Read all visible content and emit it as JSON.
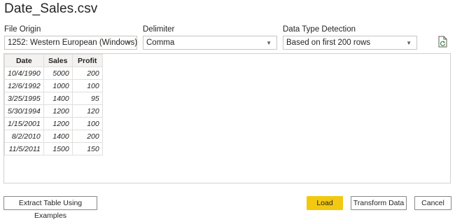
{
  "dialog": {
    "title": "Date_Sales.csv"
  },
  "file_origin": {
    "label": "File Origin",
    "value": "1252: Western European (Windows)"
  },
  "delimiter": {
    "label": "Delimiter",
    "value": "Comma"
  },
  "data_type_detection": {
    "label": "Data Type Detection",
    "value": "Based on first 200 rows"
  },
  "icons": {
    "dropdown": "chevron-down-icon",
    "refresh": "refresh-file-icon"
  },
  "table": {
    "columns": [
      "Date",
      "Sales",
      "Profit"
    ],
    "rows": [
      [
        "10/4/1990",
        "5000",
        "200"
      ],
      [
        "12/6/1992",
        "1000",
        "100"
      ],
      [
        "3/25/1995",
        "1400",
        "95"
      ],
      [
        "5/30/1994",
        "1200",
        "120"
      ],
      [
        "1/15/2001",
        "1200",
        "100"
      ],
      [
        "8/2/2010",
        "1400",
        "200"
      ],
      [
        "11/5/2011",
        "1500",
        "150"
      ]
    ]
  },
  "buttons": {
    "extract": "Extract Table Using Examples",
    "load": "Load",
    "transform": "Transform Data",
    "cancel": "Cancel"
  },
  "colors": {
    "accent": "#f2c811",
    "border": "#c8c6c4"
  }
}
